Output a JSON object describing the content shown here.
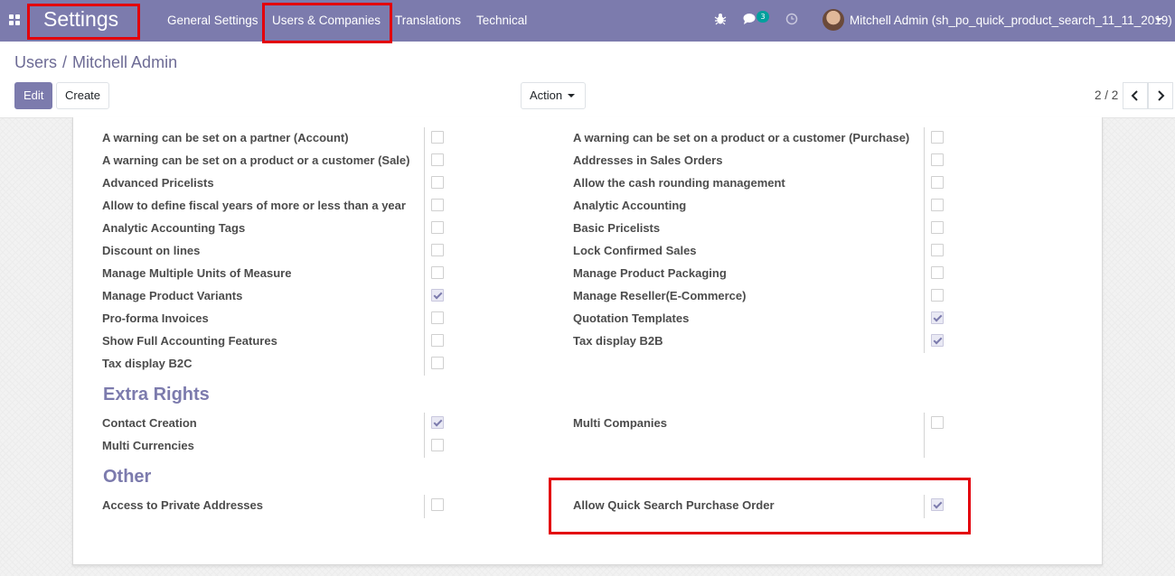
{
  "navbar": {
    "app_title": "Settings",
    "menu": [
      "General Settings",
      "Users & Companies",
      "Translations",
      "Technical"
    ],
    "chat_count": "3",
    "user_name": "Mitchell Admin (sh_po_quick_product_search_11_11_2019)"
  },
  "breadcrumb": {
    "parent": "Users",
    "separator": "/",
    "current": "Mitchell Admin"
  },
  "control_panel": {
    "edit_label": "Edit",
    "create_label": "Create",
    "action_label": "Action",
    "pager": "2 / 2"
  },
  "technical_rights": {
    "left": [
      {
        "label": "A warning can be set on a partner (Account)",
        "checked": false
      },
      {
        "label": "A warning can be set on a product or a customer (Sale)",
        "checked": false
      },
      {
        "label": "Advanced Pricelists",
        "checked": false
      },
      {
        "label": "Allow to define fiscal years of more or less than a year",
        "checked": false
      },
      {
        "label": "Analytic Accounting Tags",
        "checked": false
      },
      {
        "label": "Discount on lines",
        "checked": false
      },
      {
        "label": "Manage Multiple Units of Measure",
        "checked": false
      },
      {
        "label": "Manage Product Variants",
        "checked": true
      },
      {
        "label": "Pro-forma Invoices",
        "checked": false
      },
      {
        "label": "Show Full Accounting Features",
        "checked": false
      },
      {
        "label": "Tax display B2C",
        "checked": false
      }
    ],
    "right": [
      {
        "label": "A warning can be set on a product or a customer (Purchase)",
        "checked": false
      },
      {
        "label": "Addresses in Sales Orders",
        "checked": false
      },
      {
        "label": "Allow the cash rounding management",
        "checked": false
      },
      {
        "label": "Analytic Accounting",
        "checked": false
      },
      {
        "label": "Basic Pricelists",
        "checked": false
      },
      {
        "label": "Lock Confirmed Sales",
        "checked": false
      },
      {
        "label": "Manage Product Packaging",
        "checked": false
      },
      {
        "label": "Manage Reseller(E-Commerce)",
        "checked": false
      },
      {
        "label": "Quotation Templates",
        "checked": true
      },
      {
        "label": "Tax display B2B",
        "checked": true
      }
    ]
  },
  "extra_rights": {
    "title": "Extra Rights",
    "left": [
      {
        "label": "Contact Creation",
        "checked": true
      },
      {
        "label": "Multi Currencies",
        "checked": false
      }
    ],
    "right": [
      {
        "label": "Multi Companies",
        "checked": false
      }
    ]
  },
  "other": {
    "title": "Other",
    "left": [
      {
        "label": "Access to Private Addresses",
        "checked": false
      }
    ],
    "right": [
      {
        "label": "Allow Quick Search Purchase Order",
        "checked": true
      }
    ]
  },
  "colors": {
    "navbar": "#7c7bad",
    "annotation": "#e3000b",
    "section_title": "#7c7bad"
  },
  "icons": [
    "apps-icon",
    "bug-icon",
    "chat-icon",
    "clock-icon",
    "chevron-left-icon",
    "chevron-right-icon",
    "caret-down-icon"
  ]
}
